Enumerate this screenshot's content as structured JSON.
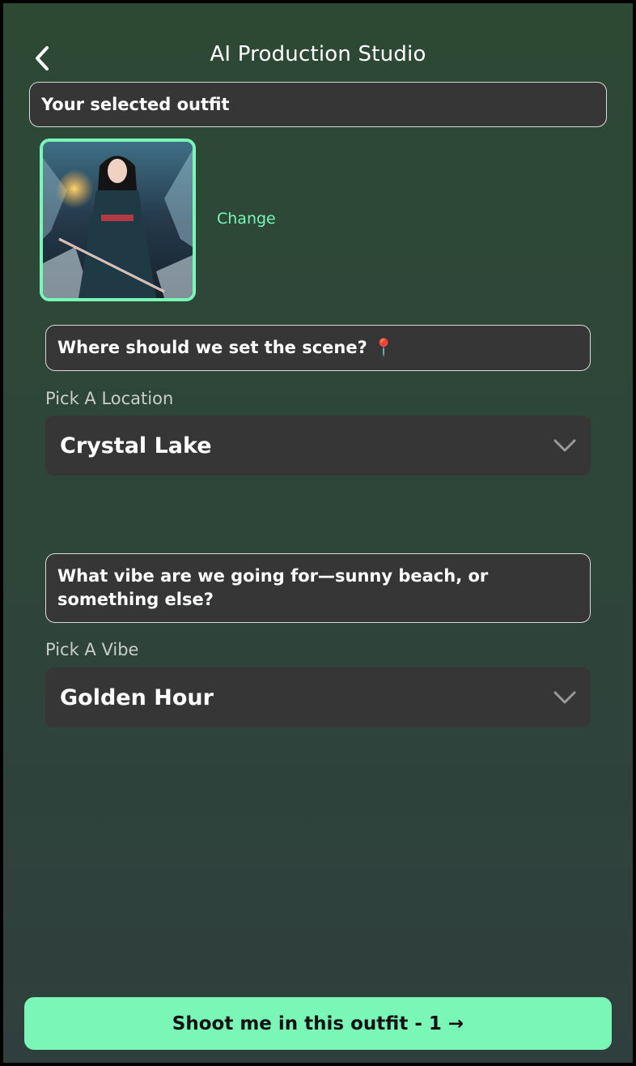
{
  "header": {
    "title": "AI Production Studio",
    "back_icon": "chevron-left-icon"
  },
  "outfit": {
    "heading": "Your selected outfit",
    "change_label": "Change",
    "accent_color": "#7af7b6"
  },
  "location": {
    "prompt": "Where should we set the scene? 📍",
    "label": "Pick A Location",
    "selected": "Crystal Lake"
  },
  "vibe": {
    "prompt": "What vibe are we going for—sunny beach, or something else?",
    "label": "Pick A Vibe",
    "selected": "Golden Hour"
  },
  "cta": {
    "label": "Shoot me in this outfit - 1 →"
  }
}
